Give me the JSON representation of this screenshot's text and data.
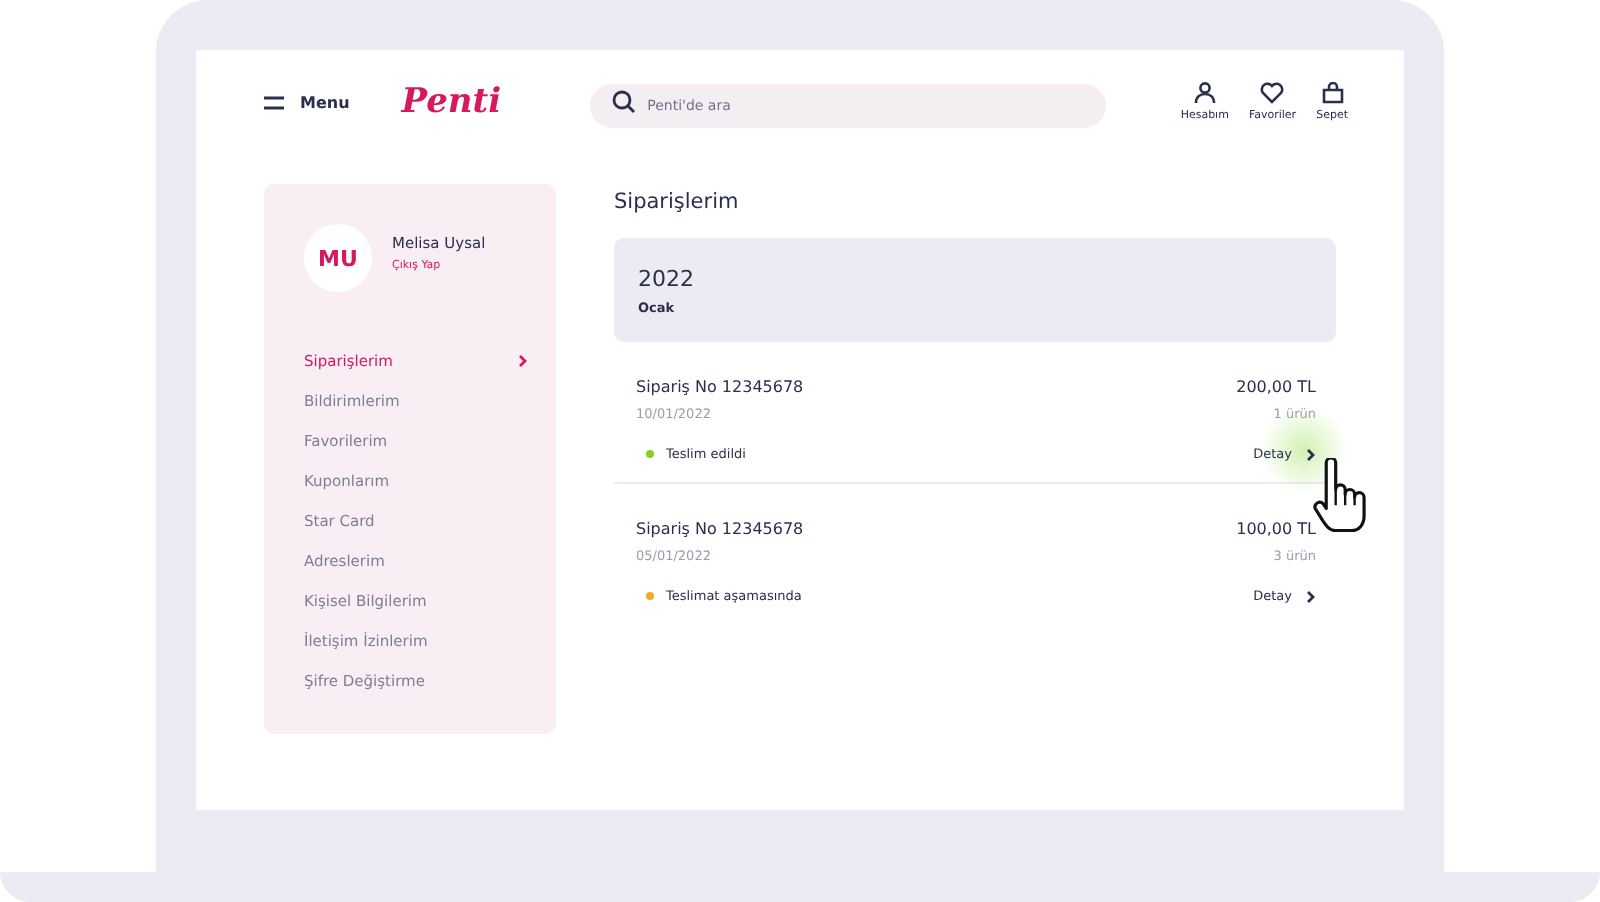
{
  "header": {
    "menu_label": "Menu",
    "logo": "Penti",
    "search": {
      "placeholder": "Penti'de ara"
    },
    "actions": [
      {
        "kind": "account",
        "label": "Hesabım"
      },
      {
        "kind": "favorites",
        "label": "Favoriler"
      },
      {
        "kind": "cart",
        "label": "Sepet"
      }
    ]
  },
  "profile": {
    "initials": "MU",
    "name": "Melisa Uysal",
    "logout": "Çıkış Yap"
  },
  "sidebar": {
    "items": [
      {
        "label": "Siparişlerim",
        "selected": true
      },
      {
        "label": "Bildirimlerim",
        "selected": false
      },
      {
        "label": "Favorilerim",
        "selected": false
      },
      {
        "label": "Kuponlarım",
        "selected": false
      },
      {
        "label": "Star Card",
        "selected": false
      },
      {
        "label": "Adreslerim",
        "selected": false
      },
      {
        "label": "Kişisel Bilgilerim",
        "selected": false
      },
      {
        "label": "İletişim İzinlerim",
        "selected": false
      },
      {
        "label": "Şifre Değiştirme",
        "selected": false
      }
    ]
  },
  "page_title": "Siparişlerim",
  "period": {
    "year": "2022",
    "month": "Ocak"
  },
  "orders": [
    {
      "number": "Sipariş No 12345678",
      "date": "10/01/2022",
      "total": "200,00 TL",
      "items": "1 ürün",
      "status": "Teslim edildi",
      "color": "#7ed321",
      "detail": "Detay",
      "hovered": true
    },
    {
      "number": "Sipariş No 12345678",
      "date": "05/01/2022",
      "total": "100,00 TL",
      "items": "3 ürün",
      "status": "Teslimat aşamasında",
      "color": "#f5a623",
      "detail": "Detay",
      "hovered": false
    }
  ]
}
